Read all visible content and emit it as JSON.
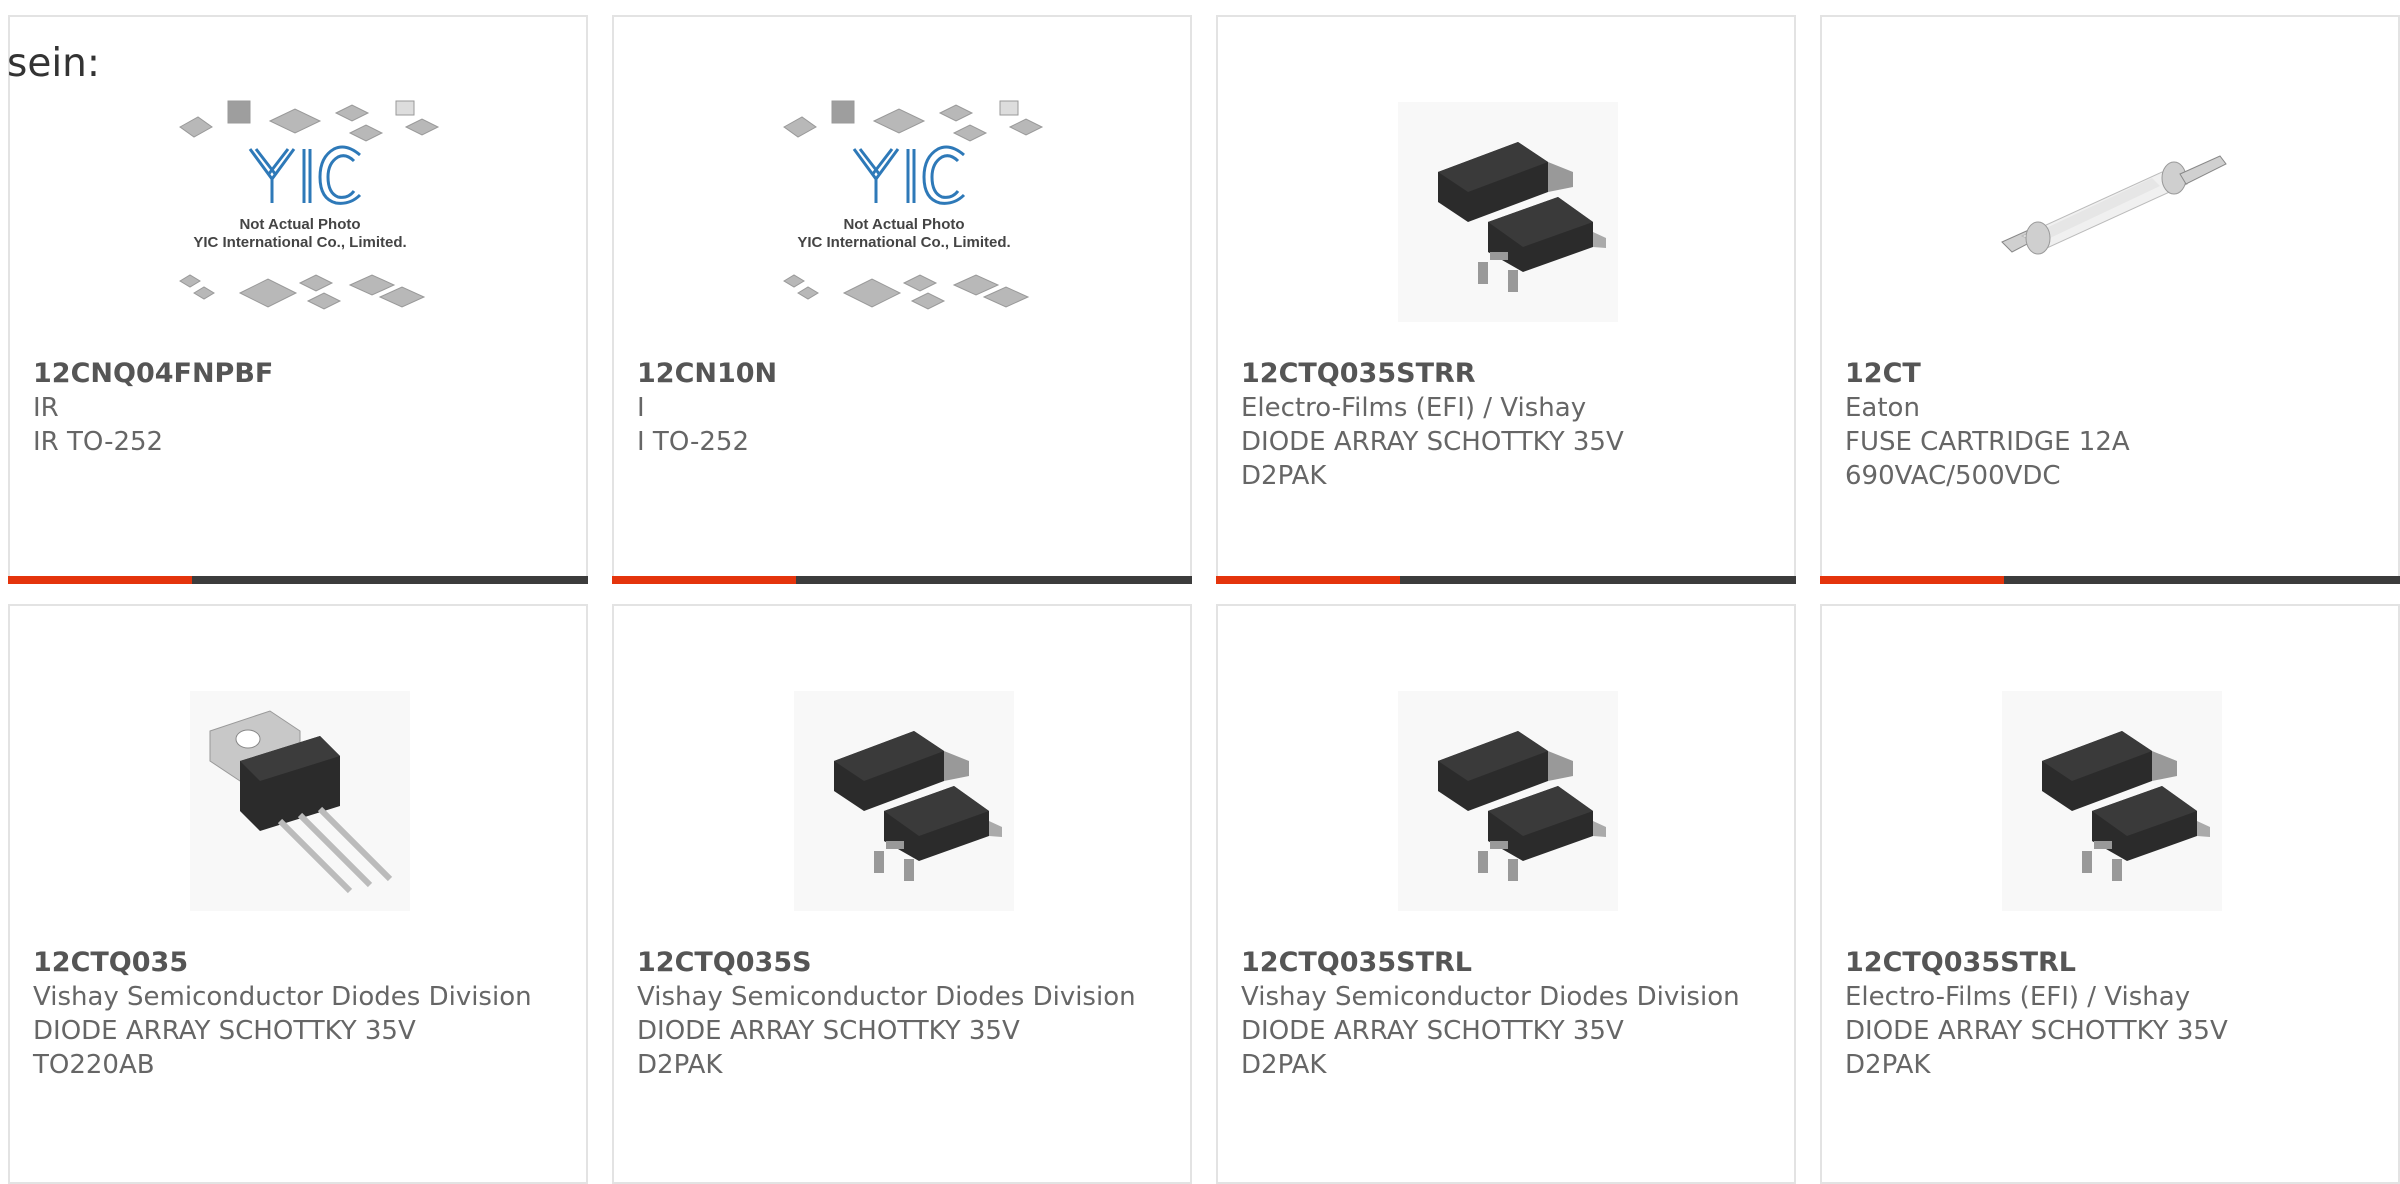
{
  "intro": {
    "text": "sein:"
  },
  "logo_text": {
    "brand": "YIC",
    "line1": "Not Actual Photo",
    "line2": "YIC International Co., Limited."
  },
  "accent_color": "#e4340c",
  "products": [
    {
      "part": "12CNQ04FNPBF",
      "maker": "IR",
      "desc": "IR TO-252",
      "image": "placeholder-logo"
    },
    {
      "part": "12CN10N",
      "maker": "I",
      "desc": "I TO-252",
      "image": "placeholder-logo"
    },
    {
      "part": "12CTQ035STRR",
      "maker": "Electro-Films (EFI) / Vishay",
      "desc": "DIODE ARRAY SCHOTTKY 35V D2PAK",
      "image": "d2pak"
    },
    {
      "part": "12CT",
      "maker": "Eaton",
      "desc": "FUSE CARTRIDGE 12A 690VAC/500VDC",
      "image": "fuse"
    },
    {
      "part": "12CTQ035",
      "maker": "Vishay Semiconductor Diodes Division",
      "desc": "DIODE ARRAY SCHOTTKY 35V TO220AB",
      "image": "to220"
    },
    {
      "part": "12CTQ035S",
      "maker": "Vishay Semiconductor Diodes Division",
      "desc": "DIODE ARRAY SCHOTTKY 35V D2PAK",
      "image": "d2pak"
    },
    {
      "part": "12CTQ035STRL",
      "maker": "Vishay Semiconductor Diodes Division",
      "desc": "DIODE ARRAY SCHOTTKY 35V D2PAK",
      "image": "d2pak"
    },
    {
      "part": "12CTQ035STRL",
      "maker": "Electro-Films (EFI) / Vishay",
      "desc": "DIODE ARRAY SCHOTTKY 35V D2PAK",
      "image": "d2pak"
    }
  ]
}
